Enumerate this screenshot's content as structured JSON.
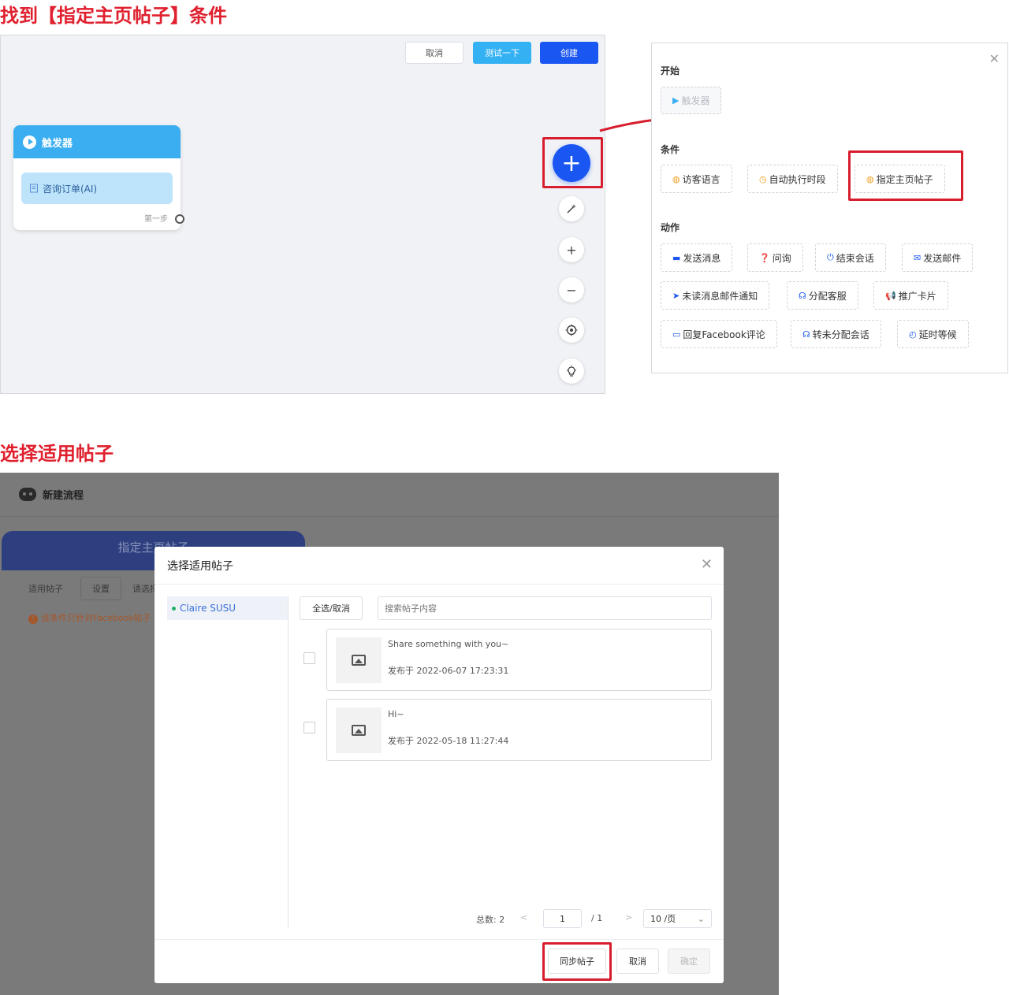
{
  "headings": {
    "section1": "找到【指定主页帖子】条件",
    "section2": "选择适用帖子"
  },
  "canvas": {
    "toolbar": {
      "cancel": "取消",
      "test": "测试一下",
      "create": "创建"
    },
    "node": {
      "title": "触发器",
      "item": "咨询订单(AI)",
      "step": "第一步"
    },
    "tools": {
      "add": "+",
      "magic": "✨",
      "zoom_in": "+",
      "zoom_out": "−",
      "locate": "⊙",
      "idea": "💡"
    },
    "colors": {
      "accent": "#1a56f2",
      "trigger": "#3aaef0",
      "highlight": "#d81e2e"
    }
  },
  "panel": {
    "close": "✕",
    "start_label": "开始",
    "trigger_chip": "触发器",
    "conditions_label": "条件",
    "conditions": [
      "访客语言",
      "自动执行时段",
      "指定主页帖子"
    ],
    "actions_label": "动作",
    "actions_row1": [
      "发送消息",
      "问询",
      "结束会话",
      "发送邮件"
    ],
    "actions_row2": [
      "未读消息邮件通知",
      "分配客服",
      "推广卡片"
    ],
    "actions_row3": [
      "回复Facebook评论",
      "转未分配会话",
      "延时等候"
    ]
  },
  "app": {
    "title": "新建流程",
    "bg_tab": "指定主页帖子",
    "bg_label1": "适用帖子",
    "bg_button": "设置",
    "bg_label2": "请选择",
    "bg_warning": "该条件只针对Facebook帖子"
  },
  "modal": {
    "title": "选择适用帖子",
    "close": "✕",
    "account": "Claire SUSU",
    "select_all": "全选/取消",
    "search_placeholder": "搜索帖子内容",
    "posts": [
      {
        "text": "Share something with you~",
        "date": "发布于 2022-06-07 17:23:31"
      },
      {
        "text": "Hi~",
        "date": "发布于 2022-05-18 11:27:44"
      }
    ],
    "pager": {
      "total": "总数: 2",
      "prev": "<",
      "current": "1",
      "of": "/ 1",
      "next": ">",
      "page_size": "10 /页",
      "dropdown": "⌄"
    },
    "buttons": {
      "sync": "同步帖子",
      "cancel": "取消",
      "confirm": "确定"
    }
  }
}
